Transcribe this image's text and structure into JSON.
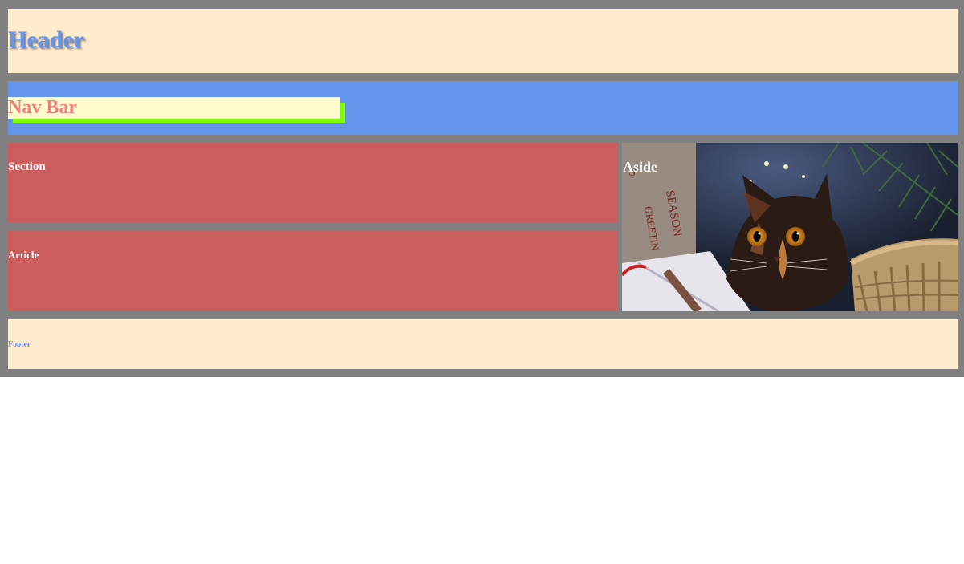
{
  "header": {
    "title": "Header"
  },
  "nav": {
    "title": "Nav Bar"
  },
  "section": {
    "title": "Section"
  },
  "article": {
    "title": "Article"
  },
  "aside": {
    "title": "Aside",
    "image": "tortoiseshell-cat-photo"
  },
  "footer": {
    "title": "Footer"
  },
  "colors": {
    "frame": "#808080",
    "header_bg": "#ffebcd",
    "header_text": "#6495ed",
    "nav_bg": "#6495ed",
    "nav_box": "#fffacd",
    "nav_shadow": "#7cfc00",
    "nav_text": "#f08080",
    "content_bg": "#cd5c5c",
    "content_text": "#ffffff"
  }
}
